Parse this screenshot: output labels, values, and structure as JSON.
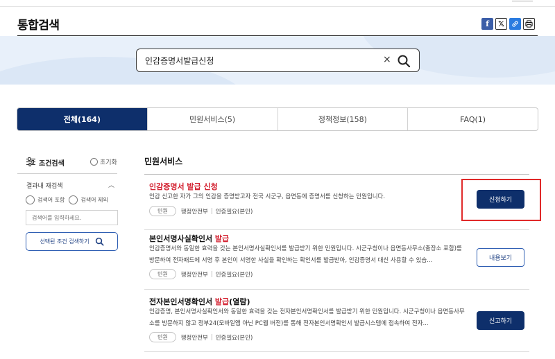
{
  "header": {
    "title": "통합검색"
  },
  "share": {
    "facebook": "f",
    "x": "𝕏",
    "link": "🔗",
    "print": "⎙"
  },
  "search": {
    "value": "인감증명서발급신청",
    "clear": "×"
  },
  "tabs": [
    {
      "label": "전체(164)",
      "active": true
    },
    {
      "label": "민원서비스(5)",
      "active": false
    },
    {
      "label": "정책정보(158)",
      "active": false
    },
    {
      "label": "FAQ(1)",
      "active": false
    }
  ],
  "sidebar": {
    "filter_title": "조건검색",
    "reset": "초기화",
    "refine_title": "결과내 재검색",
    "include": "검색어 포함",
    "exclude": "검색어 제외",
    "input_placeholder": "검색어를 입력하세요.",
    "search_button": "선택된 조건 검색하기"
  },
  "section": {
    "title": "민원서비스"
  },
  "results": [
    {
      "title": "인감증명서 발급 신청",
      "desc": "인감 신고한 자가 그의 인감을 증명받고자 전국 시군구, 읍면동에 증명서를 신청하는 민원입니다.",
      "badge": "민원",
      "agency": "행정안전부",
      "auth": "인증필요(본인)",
      "button": "신청하기"
    },
    {
      "title_plain": "본인서명사실확인서 ",
      "title_hl": "발급",
      "desc": "인감증명서와 동일한 효력을 갖는 본인서명사실확인서를 발급받기 위한 민원입니다. 시군구청이나 읍면동사무소(출장소 포함)를 방문하여 전자패드에 서명 후 본인이 서명한 사실을 확인하는 확인서를 발급받아, 인감증명서 대신 사용할 수 있습...",
      "badge": "민원",
      "agency": "행정안전부",
      "auth": "인증필요(본인)",
      "button": "내용보기"
    },
    {
      "title_plain": "전자본인서명확인서 ",
      "title_hl": "발급",
      "title_tail": "(열람)",
      "desc": "인감증명, 본인서명사실확인서와 동일한 효력을 갖는 전자본인서명확인서를 발급받기 위한 민원입니다. 시군구청이나 읍면동사무소를 방문하지 않고 정부24(모바일앱 아닌 PC웹 버전)를 통해 전자본인서명확인서 발급시스템에 접속하여 전자...",
      "badge": "민원",
      "agency": "행정안전부",
      "auth": "인증필요(본인)",
      "button": "신고하기"
    }
  ]
}
